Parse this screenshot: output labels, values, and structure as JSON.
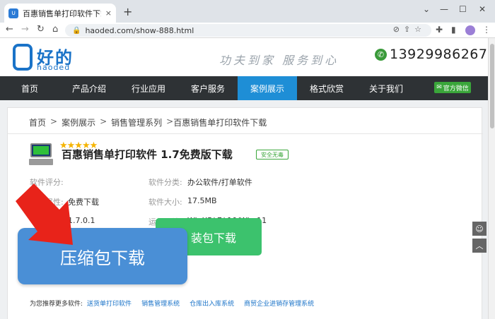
{
  "browser": {
    "tab_title": "百惠销售单打印软件下载 送货开单…",
    "tab_close": "×",
    "new_tab": "+",
    "window_controls": [
      "⌄",
      "—",
      "☐",
      "✕"
    ],
    "nav": [
      "←",
      "→",
      "↻",
      "⌂"
    ],
    "url": "haoded.com/show-888.html",
    "lock": "🔒"
  },
  "site": {
    "logo_cn": "好的",
    "logo_en": "haoded",
    "slogan": "功夫到家  服务到心",
    "phone": "13929986267",
    "phone_icon": "✆",
    "menu": [
      {
        "label": "首页",
        "active": false
      },
      {
        "label": "产品介绍",
        "active": false
      },
      {
        "label": "行业应用",
        "active": false
      },
      {
        "label": "客户服务",
        "active": false
      },
      {
        "label": "案例展示",
        "active": true
      },
      {
        "label": "格式欣赏",
        "active": false
      },
      {
        "label": "关于我们",
        "active": false
      }
    ],
    "wechat": "官方微信",
    "breadcrumb": [
      "首页",
      "案例展示",
      "销售管理系列",
      "百惠销售单打印软件下载"
    ],
    "breadcrumb_sep": ">",
    "software": {
      "title": "百惠销售单打印软件 1.7免费版下载",
      "safe_badge": "安全无毒",
      "rating_label": "软件评分:",
      "rating_stars": "★★★★★",
      "category_label": "软件分类:",
      "category": "办公软件/打单软件",
      "attr_label": "软件属性:",
      "attr": "免费下载",
      "size_label": "软件大小:",
      "size": "17.5MB",
      "version": "1.7.0.1",
      "env_label": "运行环境:",
      "env": "WinXP/ 7/ 10/Win 11"
    },
    "buttons": {
      "install": "装包下载",
      "zip": "压缩包下载"
    },
    "recommend": {
      "label": "为您推荐更多软件:",
      "links": [
        "送货单打印软件",
        "销售管理系统",
        "仓库出入库系统",
        "商贸企业进销存管理系统"
      ]
    }
  },
  "colors": {
    "accent": "#1e8ed6",
    "arrow": "#e8231a",
    "green": "#3cc26d",
    "blue_button": "#4a8fd6"
  }
}
